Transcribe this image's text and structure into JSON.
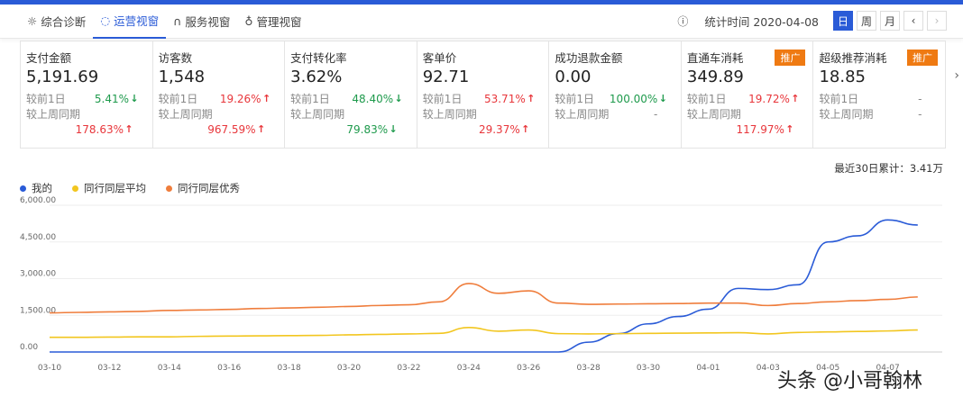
{
  "nav": {
    "tabs": [
      {
        "label": "综合诊断",
        "icon": "bulb-icon"
      },
      {
        "label": "运营视窗",
        "icon": "refresh-icon"
      },
      {
        "label": "服务视窗",
        "icon": "headset-icon"
      },
      {
        "label": "管理视窗",
        "icon": "person-icon"
      }
    ],
    "stat_time": "统计时间 2020-04-08",
    "periods": [
      "日",
      "周",
      "月"
    ],
    "prev": "‹",
    "next": "›"
  },
  "cards": [
    {
      "title": "支付金额",
      "value": "5,191.69",
      "d1": "5.41%",
      "d1dir": "down",
      "wk": "178.63%",
      "wkdir": "up"
    },
    {
      "title": "访客数",
      "value": "1,548",
      "d1": "19.26%",
      "d1dir": "up",
      "wk": "967.59%",
      "wkdir": "up"
    },
    {
      "title": "支付转化率",
      "value": "3.62%",
      "d1": "48.40%",
      "d1dir": "down",
      "wk": "79.83%",
      "wkdir": "down"
    },
    {
      "title": "客单价",
      "value": "92.71",
      "d1": "53.71%",
      "d1dir": "up",
      "wk": "29.37%",
      "wkdir": "up"
    },
    {
      "title": "成功退款金额",
      "value": "0.00",
      "d1": "100.00%",
      "d1dir": "down",
      "wk": "-",
      "wkdir": "none"
    },
    {
      "title": "直通车消耗",
      "value": "349.89",
      "d1": "19.72%",
      "d1dir": "up",
      "wk": "117.97%",
      "wkdir": "up",
      "promo": "推广"
    },
    {
      "title": "超级推荐消耗",
      "value": "18.85",
      "d1": "-",
      "d1dir": "none",
      "wk": "-",
      "wkdir": "none",
      "promo": "推广"
    }
  ],
  "labels": {
    "d1": "较前1日",
    "wk": "较上周同期"
  },
  "total": "最近30日累计：3.41万",
  "watermark": "头条 @小哥翰林",
  "chart_data": {
    "type": "line",
    "ylim": [
      0,
      6000
    ],
    "yticks": [
      "0.00",
      "1,500.00",
      "3,000.00",
      "4,500.00",
      "6,000.00"
    ],
    "x": [
      "03-10",
      "03-11",
      "03-12",
      "03-13",
      "03-14",
      "03-15",
      "03-16",
      "03-17",
      "03-18",
      "03-19",
      "03-20",
      "03-21",
      "03-22",
      "03-23",
      "03-24",
      "03-25",
      "03-26",
      "03-27",
      "03-28",
      "03-29",
      "03-30",
      "03-31",
      "04-01",
      "04-02",
      "04-03",
      "04-04",
      "04-05",
      "04-06",
      "04-07",
      "04-08"
    ],
    "xticks": [
      "03-10",
      "03-12",
      "03-14",
      "03-16",
      "03-18",
      "03-20",
      "03-22",
      "03-24",
      "03-26",
      "03-28",
      "03-30",
      "04-01",
      "04-03",
      "04-05",
      "04-07"
    ],
    "series": [
      {
        "name": "我的",
        "color": "#2a5bd7",
        "values": [
          0,
          0,
          0,
          0,
          0,
          0,
          0,
          0,
          0,
          0,
          0,
          0,
          0,
          0,
          0,
          0,
          0,
          0,
          400,
          750,
          1150,
          1450,
          1750,
          2600,
          2550,
          2750,
          4500,
          4750,
          5400,
          5192
        ]
      },
      {
        "name": "同行同层平均",
        "color": "#f2c61f",
        "values": [
          600,
          600,
          610,
          620,
          620,
          640,
          650,
          660,
          670,
          680,
          700,
          720,
          740,
          760,
          1000,
          850,
          900,
          750,
          740,
          750,
          760,
          770,
          780,
          790,
          740,
          800,
          820,
          840,
          860,
          900
        ]
      },
      {
        "name": "同行同层优秀",
        "color": "#ef7d3c",
        "values": [
          1600,
          1620,
          1640,
          1660,
          1700,
          1720,
          1740,
          1780,
          1800,
          1830,
          1860,
          1900,
          1930,
          2050,
          2800,
          2400,
          2500,
          2000,
          1950,
          1960,
          1970,
          1980,
          2000,
          2000,
          1900,
          1980,
          2050,
          2100,
          2150,
          2250
        ]
      }
    ]
  }
}
